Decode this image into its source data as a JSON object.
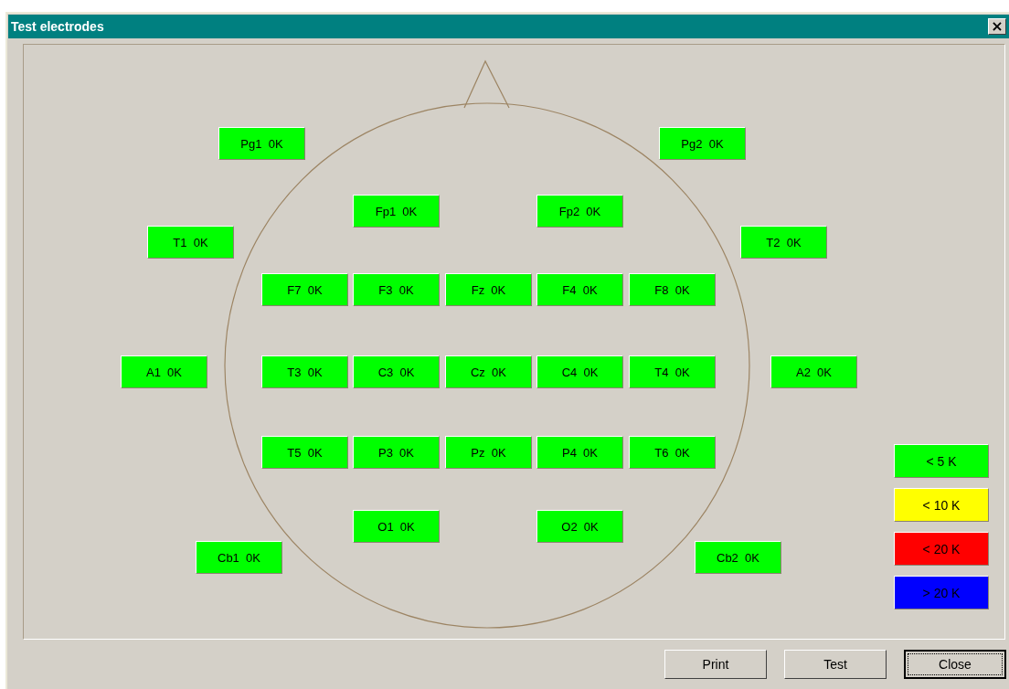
{
  "window": {
    "title": "Test electrodes",
    "close": "×"
  },
  "electrodes": [
    {
      "name": "Pg1",
      "reading": "0K",
      "color": "#00ff00"
    },
    {
      "name": "Pg2",
      "reading": "0K",
      "color": "#00ff00"
    },
    {
      "name": "Fp1",
      "reading": "0K",
      "color": "#00ff00"
    },
    {
      "name": "Fp2",
      "reading": "0K",
      "color": "#00ff00"
    },
    {
      "name": "T1",
      "reading": "0K",
      "color": "#00ff00"
    },
    {
      "name": "T2",
      "reading": "0K",
      "color": "#00ff00"
    },
    {
      "name": "F7",
      "reading": "0K",
      "color": "#00ff00"
    },
    {
      "name": "F3",
      "reading": "0K",
      "color": "#00ff00"
    },
    {
      "name": "Fz",
      "reading": "0K",
      "color": "#00ff00"
    },
    {
      "name": "F4",
      "reading": "0K",
      "color": "#00ff00"
    },
    {
      "name": "F8",
      "reading": "0K",
      "color": "#00ff00"
    },
    {
      "name": "A1",
      "reading": "0K",
      "color": "#00ff00"
    },
    {
      "name": "T3",
      "reading": "0K",
      "color": "#00ff00"
    },
    {
      "name": "C3",
      "reading": "0K",
      "color": "#00ff00"
    },
    {
      "name": "Cz",
      "reading": "0K",
      "color": "#00ff00"
    },
    {
      "name": "C4",
      "reading": "0K",
      "color": "#00ff00"
    },
    {
      "name": "T4",
      "reading": "0K",
      "color": "#00ff00"
    },
    {
      "name": "A2",
      "reading": "0K",
      "color": "#00ff00"
    },
    {
      "name": "T5",
      "reading": "0K",
      "color": "#00ff00"
    },
    {
      "name": "P3",
      "reading": "0K",
      "color": "#00ff00"
    },
    {
      "name": "Pz",
      "reading": "0K",
      "color": "#00ff00"
    },
    {
      "name": "P4",
      "reading": "0K",
      "color": "#00ff00"
    },
    {
      "name": "T6",
      "reading": "0K",
      "color": "#00ff00"
    },
    {
      "name": "O1",
      "reading": "0K",
      "color": "#00ff00"
    },
    {
      "name": "O2",
      "reading": "0K",
      "color": "#00ff00"
    },
    {
      "name": "Cb1",
      "reading": "0K",
      "color": "#00ff00"
    },
    {
      "name": "Cb2",
      "reading": "0K",
      "color": "#00ff00"
    }
  ],
  "legend": [
    {
      "label": "< 5 K",
      "color": "#00ff00"
    },
    {
      "label": "< 10 K",
      "color": "#ffff00"
    },
    {
      "label": "< 20 K",
      "color": "#ff0000"
    },
    {
      "label": "> 20 K",
      "color": "#0000ff"
    }
  ],
  "buttons": [
    {
      "label": "Print",
      "focused": false
    },
    {
      "label": "Test",
      "focused": false
    },
    {
      "label": "Close",
      "focused": true
    }
  ]
}
